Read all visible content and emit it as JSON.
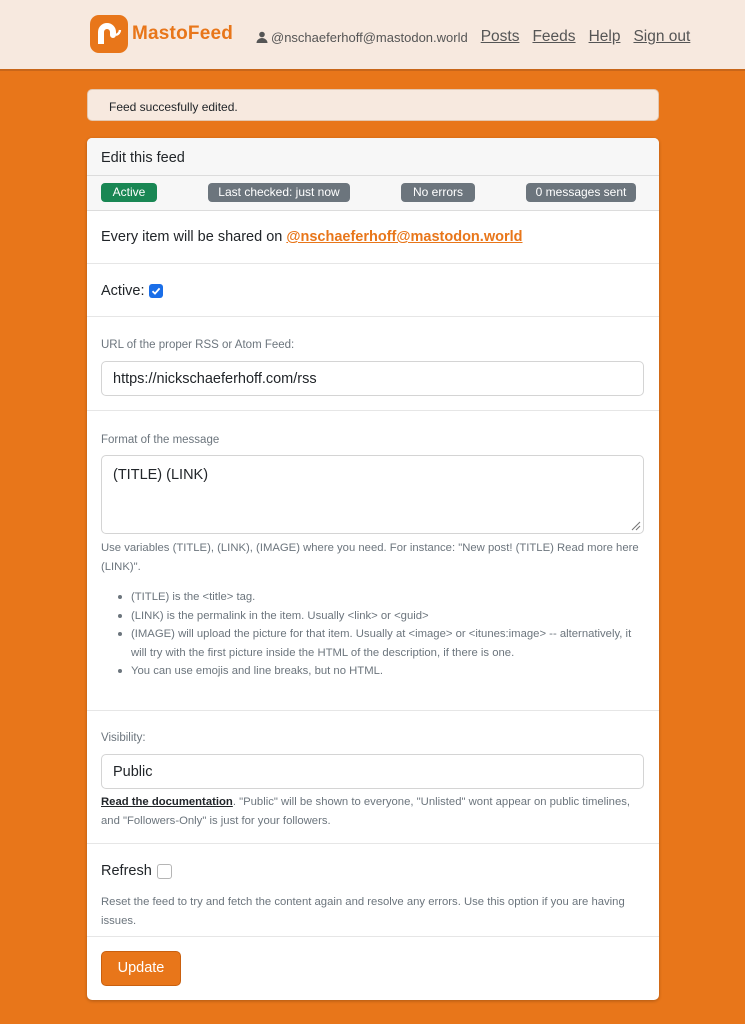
{
  "brand": {
    "name": "MastoFeed",
    "accent": "#e8761a"
  },
  "nav": {
    "user": "@nschaeferhoff@mastodon.world",
    "links": [
      "Posts",
      "Feeds",
      "Help",
      "Sign out"
    ]
  },
  "alert": {
    "text": "Feed succesfully edited."
  },
  "card": {
    "title": "Edit this feed",
    "badges": {
      "status": "Active",
      "last_checked": "Last checked: just now",
      "errors": "No errors",
      "messages": "0 messages sent"
    },
    "share": {
      "prefix": "Every item will be shared on ",
      "account": "@nschaeferhoff@mastodon.world"
    },
    "active": {
      "label": "Active:",
      "checked": true
    },
    "url": {
      "label": "URL of the proper RSS or Atom Feed:",
      "value": "https://nickschaeferhoff.com/rss"
    },
    "format": {
      "label": "Format of the message",
      "value": "(TITLE) (LINK)",
      "help": "Use variables (TITLE), (LINK), (IMAGE) where you need. For instance: \"New post! (TITLE) Read more here (LINK)\".",
      "bullets": [
        "(TITLE) is the <title> tag.",
        "(LINK) is the permalink in the item. Usually <link> or <guid>",
        "(IMAGE) will upload the picture for that item. Usually at <image> or <itunes:image> -- alternatively, it will try with the first picture inside the HTML of the description, if there is one.",
        "You can use emojis and line breaks, but no HTML."
      ]
    },
    "visibility": {
      "label": "Visibility:",
      "value": "Public",
      "doc_link": "Read the documentation",
      "help": ". \"Public\" will be shown to everyone, \"Unlisted\" wont appear on public timelines, and \"Followers-Only\" is just for your followers."
    },
    "refresh": {
      "label": "Refresh",
      "checked": false,
      "help": "Reset the feed to try and fetch the content again and resolve any errors. Use this option if you are having issues."
    },
    "submit_label": "Update"
  }
}
